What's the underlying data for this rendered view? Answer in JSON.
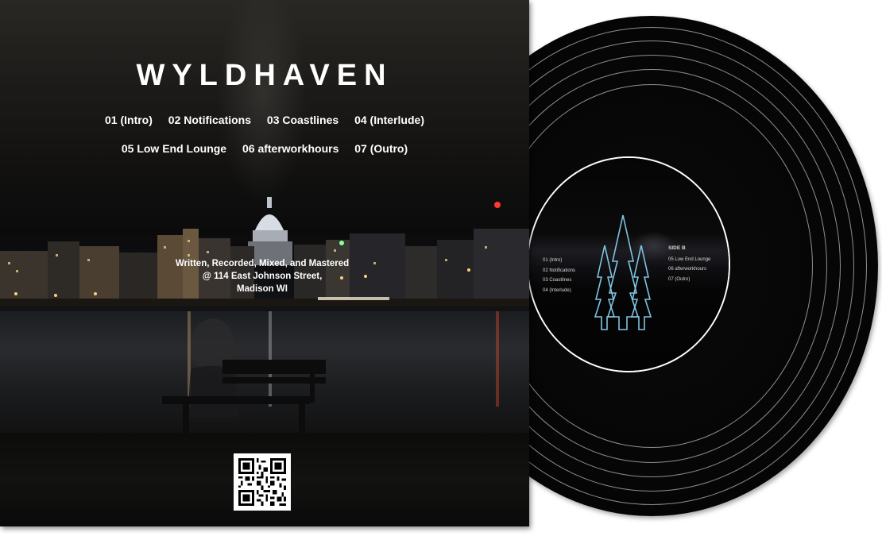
{
  "album": {
    "title": "WYLDHAVEN",
    "tracks_row1": [
      "01 (Intro)",
      "02 Notifications",
      "03 Coastlines",
      "04 (Interlude)"
    ],
    "tracks_row2": [
      "05 Low End Lounge",
      "06 afterworkhours",
      "07 (Outro)"
    ],
    "credits": [
      "Written, Recorded, Mixed, and Mastered",
      "@ 114 East Johnson Street,",
      "Madison WI"
    ]
  },
  "record_label": {
    "side_a_tracks": [
      "01 (Intro)",
      "02 Notifications",
      "03 Coastlines",
      "04 (Interlude)"
    ],
    "side_b_title": "SIDE B",
    "side_b_tracks": [
      "05 Low End Lounge",
      "06 afterworkhours",
      "07 (Outro)"
    ]
  },
  "colors": {
    "tree_outline": "#7fc4e0",
    "text": "#ffffff"
  }
}
